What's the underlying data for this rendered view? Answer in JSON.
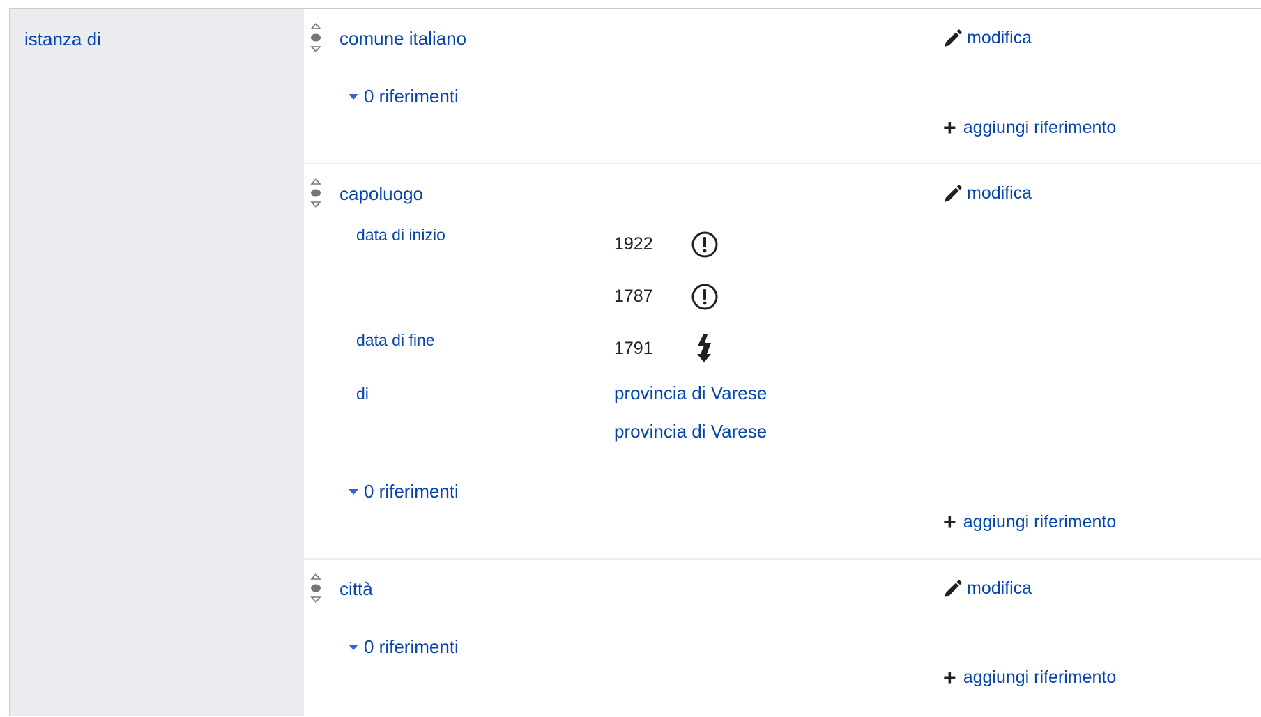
{
  "property": {
    "label": "istanza di"
  },
  "statements": [
    {
      "value": "comune italiano",
      "edit_label": "modifica",
      "references_label": "0 riferimenti",
      "add_reference_label": "aggiungi riferimento"
    },
    {
      "value": "capoluogo",
      "edit_label": "modifica",
      "qualifiers": [
        {
          "property": "data di inizio",
          "values": [
            "1922",
            "1787"
          ],
          "icons": [
            "exclamation-circle-icon",
            "exclamation-circle-icon"
          ]
        },
        {
          "property": "data di fine",
          "values": [
            "1791"
          ],
          "icons": [
            "lightning-icon"
          ]
        },
        {
          "property": "di",
          "values": [
            "provincia di Varese",
            "provincia di Varese"
          ]
        }
      ],
      "references_label": "0 riferimenti",
      "add_reference_label": "aggiungi riferimento"
    },
    {
      "value": "città",
      "edit_label": "modifica",
      "references_label": "0 riferimenti",
      "add_reference_label": "aggiungi riferimento"
    }
  ],
  "colors": {
    "link": "#0645ad",
    "sidebar_bg": "#eaecf0",
    "border": "#c8ccd1",
    "icon": "#202122"
  }
}
